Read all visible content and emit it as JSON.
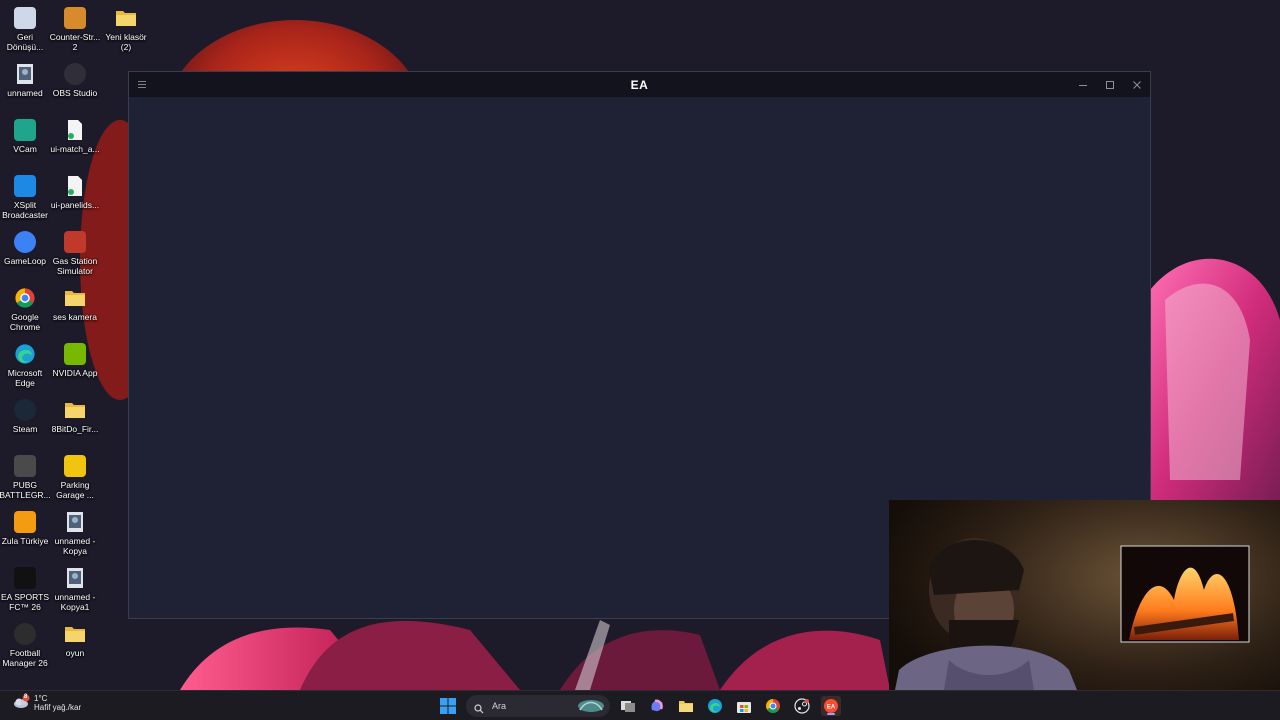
{
  "desktop_icons": [
    {
      "id": "recycle-bin",
      "label": "Geri Dönüşü...",
      "icon": "recycle-bin-icon",
      "color": "#cfd8e8"
    },
    {
      "id": "counter-strike",
      "label": "Counter-Str... 2",
      "icon": "counter-strike-icon",
      "color": "#d88b2b"
    },
    {
      "id": "yeni-klasor",
      "label": "Yeni klasör (2)",
      "icon": "folder-icon",
      "color": "#f2c94c"
    },
    {
      "id": "unnamed",
      "label": "unnamed",
      "icon": "image-file-icon",
      "color": "#7f8fa6"
    },
    {
      "id": "obs",
      "label": "OBS Studio",
      "icon": "obs-icon",
      "color": "#302e38"
    },
    {
      "id": "vcam",
      "label": "VCam",
      "icon": "vcam-icon",
      "color": "#1fa58b"
    },
    {
      "id": "ui-match",
      "label": "ui-match_a...",
      "icon": "file-icon",
      "color": "#f2f2f2"
    },
    {
      "id": "xsplit",
      "label": "XSplit Broadcaster",
      "icon": "xsplit-icon",
      "color": "#1e88e5"
    },
    {
      "id": "ui-panelids",
      "label": "ui-panelids...",
      "icon": "file-icon",
      "color": "#f2f2f2"
    },
    {
      "id": "gameloop",
      "label": "GameLoop",
      "icon": "gameloop-icon",
      "color": "#3b82f6"
    },
    {
      "id": "gas-station",
      "label": "Gas Station Simulator",
      "icon": "gas-station-icon",
      "color": "#c0392b"
    },
    {
      "id": "chrome",
      "label": "Google Chrome",
      "icon": "chrome-icon",
      "color": "#4285f4"
    },
    {
      "id": "ses-kamera",
      "label": "ses kamera",
      "icon": "folder-icon",
      "color": "#f2c94c"
    },
    {
      "id": "edge",
      "label": "Microsoft Edge",
      "icon": "edge-icon",
      "color": "#1ba0d8"
    },
    {
      "id": "nvidia",
      "label": "NVIDIA App",
      "icon": "nvidia-icon",
      "color": "#76b900"
    },
    {
      "id": "steam",
      "label": "Steam",
      "icon": "steam-icon",
      "color": "#1b2838"
    },
    {
      "id": "8bitdo",
      "label": "8BitDo_Fir...",
      "icon": "folder-icon",
      "color": "#f2c94c"
    },
    {
      "id": "pubg",
      "label": "PUBG BATTLEGR...",
      "icon": "pubg-icon",
      "color": "#4a4a4a"
    },
    {
      "id": "parking-garage",
      "label": "Parking Garage ...",
      "icon": "parking-garage-icon",
      "color": "#f1c40f"
    },
    {
      "id": "zula",
      "label": "Zula Türkiye",
      "icon": "zula-icon",
      "color": "#f39c12"
    },
    {
      "id": "unnamed-kopya",
      "label": "unnamed - Kopya",
      "icon": "image-file-icon",
      "color": "#7f8fa6"
    },
    {
      "id": "ea-sports-fc",
      "label": "EA SPORTS FC™ 26",
      "icon": "ea-fc-icon",
      "color": "#111111"
    },
    {
      "id": "unnamed-kopya1",
      "label": "unnamed - Kopya1",
      "icon": "image-file-icon",
      "color": "#7f8fa6"
    },
    {
      "id": "football-manager",
      "label": "Football Manager 26",
      "icon": "football-manager-icon",
      "color": "#2d2d2d"
    },
    {
      "id": "oyun",
      "label": "oyun",
      "icon": "folder-icon",
      "color": "#f2c94c"
    }
  ],
  "ea_window": {
    "title": "EA",
    "menu_icon": "hamburger-menu-icon",
    "controls": [
      "minimize-icon",
      "maximize-icon",
      "close-icon"
    ]
  },
  "taskbar": {
    "weather": {
      "temp": "1°C",
      "desc": "Hafif yağ./kar",
      "badge": "8"
    },
    "search_placeholder": "Ara",
    "apps": [
      "start-icon",
      "task-view-icon",
      "copilot-icon",
      "file-explorer-icon",
      "edge-icon",
      "store-icon",
      "chrome-icon",
      "steam-app-icon",
      "ea-app-icon"
    ]
  },
  "colors": {
    "window_bg": "#1f2234",
    "titlebar_bg": "#12131c",
    "taskbar_bg": "#1c1b22"
  }
}
